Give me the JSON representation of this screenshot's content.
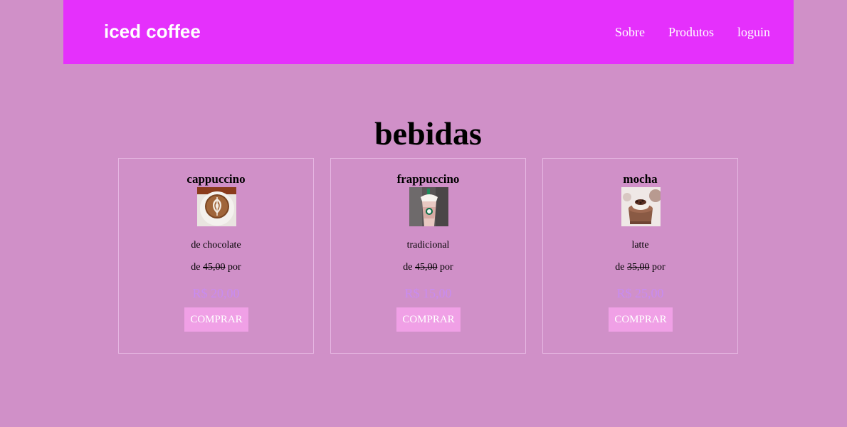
{
  "header": {
    "brand": "iced coffee",
    "nav": [
      "Sobre",
      "Produtos",
      "loguin"
    ]
  },
  "main": {
    "title": "bebidas",
    "products": [
      {
        "name": "cappuccino",
        "image_icon": "cappuccino-latte-art-image",
        "description": "de chocolate",
        "old_prefix": "de",
        "old_price": "45,00",
        "old_suffix": "por",
        "price": "R$ 20,00",
        "button": "COMPRAR"
      },
      {
        "name": "frappuccino",
        "image_icon": "frappuccino-cup-image",
        "description": "tradicional",
        "old_prefix": "de",
        "old_price": "45,00",
        "old_suffix": "por",
        "price": "R$ 15,00",
        "button": "COMPRAR"
      },
      {
        "name": "mocha",
        "image_icon": "mocha-dessert-image",
        "description": "latte",
        "old_prefix": "de",
        "old_price": "35,00",
        "old_suffix": "por",
        "price": "R$ 25,00",
        "button": "COMPRAR"
      }
    ]
  },
  "colors": {
    "page_background": "#d090c8",
    "header_background": "#e530fc",
    "card_border": "#e6b6e2",
    "price_text": "#c88cf0",
    "button_background": "#f0a0e6",
    "button_text": "#ffffff"
  }
}
